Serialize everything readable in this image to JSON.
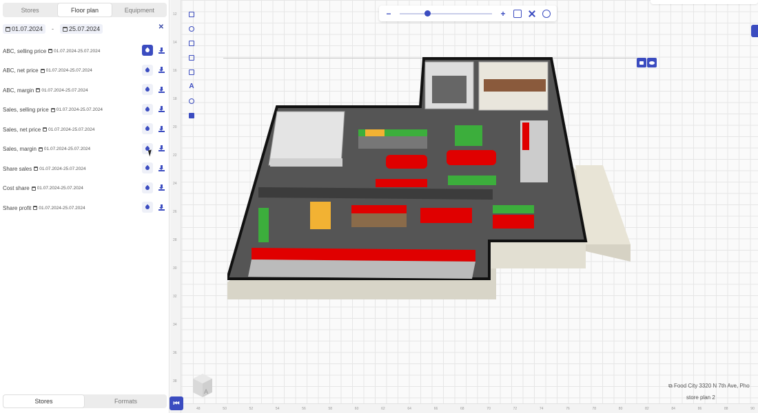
{
  "tabs": [
    "Stores",
    "Floor plan",
    "Equipment"
  ],
  "active_tab": "Floor plan",
  "date_from": "01.07.2024",
  "date_to": "25.07.2024",
  "date_separator": "-",
  "metrics": [
    {
      "label": "ABC, selling price",
      "range": "01.07.2024-25.07.2024",
      "active": true
    },
    {
      "label": "ABC, net price",
      "range": "01.07.2024-25.07.2024",
      "active": false
    },
    {
      "label": "ABC, margin",
      "range": "01.07.2024-25.07.2024",
      "active": false
    },
    {
      "label": "Sales, selling price",
      "range": "01.07.2024-25.07.2024",
      "active": false
    },
    {
      "label": "Sales, net price",
      "range": "01.07.2024-25.07.2024",
      "active": false
    },
    {
      "label": "Sales, margin",
      "range": "01.07.2024-25.07.2024",
      "active": false
    },
    {
      "label": "Share sales",
      "range": "01.07.2024-25.07.2024",
      "active": false
    },
    {
      "label": "Cost share",
      "range": "01.07.2024-25.07.2024",
      "active": false
    },
    {
      "label": "Share profit",
      "range": "01.07.2024-25.07.2024",
      "active": false
    }
  ],
  "bottom_tabs": [
    "Stores",
    "Formats"
  ],
  "zoom": {
    "minus": "−",
    "plus": "+",
    "level": 0.27
  },
  "store_info": "Food City 3320 N 7th Ave, Pho",
  "plan_name": "store plan 2",
  "cube_label": "A",
  "vruler_ticks": [
    "12",
    "14",
    "16",
    "18",
    "20",
    "22",
    "24",
    "26",
    "28",
    "30",
    "32",
    "34",
    "36",
    "38",
    "40"
  ],
  "hruler_ticks": [
    "48",
    "50",
    "52",
    "54",
    "56",
    "58",
    "60",
    "62",
    "64",
    "66",
    "68",
    "70",
    "72",
    "74",
    "76",
    "78",
    "80",
    "82",
    "84",
    "86",
    "88",
    "90"
  ],
  "colors": {
    "accent": "#3b4cc0",
    "red_shelf": "#e00000",
    "green_shelf": "#3cae3c",
    "yellow_shelf": "#f2b233"
  }
}
